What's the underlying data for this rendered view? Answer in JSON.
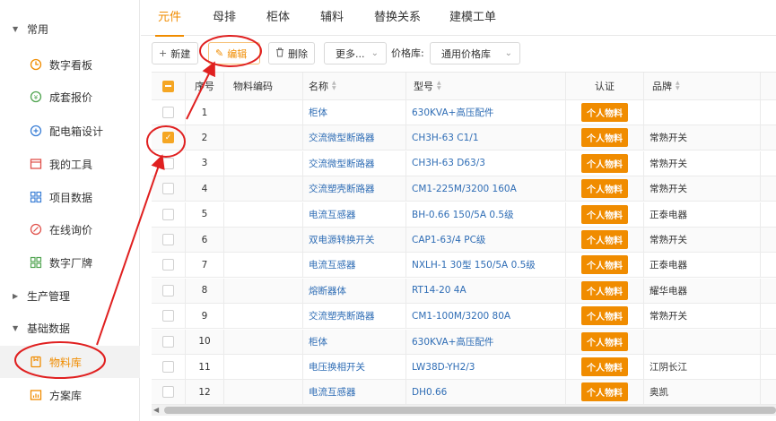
{
  "sidebar": {
    "groups": [
      {
        "label": "常用",
        "caret": "▼"
      },
      {
        "label": "生产管理",
        "caret": "▶"
      },
      {
        "label": "基础数据",
        "caret": "▼"
      }
    ],
    "items": [
      {
        "label": "数字看板",
        "icon": "dashboard-icon"
      },
      {
        "label": "成套报价",
        "icon": "quote-icon"
      },
      {
        "label": "配电箱设计",
        "icon": "design-icon"
      },
      {
        "label": "我的工具",
        "icon": "tools-icon"
      },
      {
        "label": "项目数据",
        "icon": "project-data-icon"
      },
      {
        "label": "在线询价",
        "icon": "inquiry-icon"
      },
      {
        "label": "数字厂牌",
        "icon": "brand-icon"
      },
      {
        "label": "物料库",
        "icon": "material-library-icon",
        "active": true
      },
      {
        "label": "方案库",
        "icon": "scheme-library-icon"
      }
    ]
  },
  "tabs": [
    "元件",
    "母排",
    "柜体",
    "辅料",
    "替换关系",
    "建模工单"
  ],
  "toolbar": {
    "new_label": "新建",
    "edit_label": "编辑",
    "delete_label": "删除",
    "more_label": "更多...",
    "price_lib_label": "价格库:",
    "price_lib_value": "通用价格库"
  },
  "table": {
    "headers": [
      "序号",
      "物料编码",
      "名称",
      "型号",
      "认证",
      "品牌"
    ],
    "rows": [
      {
        "no": "1",
        "code": "",
        "name": "柜体",
        "model": "630KVA+高压配件",
        "cert": "个人物料",
        "brand": "",
        "checked": false
      },
      {
        "no": "2",
        "code": "",
        "name": "交流微型断路器",
        "model": "CH3H-63 C1/1",
        "cert": "个人物料",
        "brand": "常熟开关",
        "checked": true
      },
      {
        "no": "3",
        "code": "",
        "name": "交流微型断路器",
        "model": "CH3H-63 D63/3",
        "cert": "个人物料",
        "brand": "常熟开关",
        "checked": false
      },
      {
        "no": "4",
        "code": "",
        "name": "交流塑壳断路器",
        "model": "CM1-225M/3200 160A",
        "cert": "个人物料",
        "brand": "常熟开关",
        "checked": false
      },
      {
        "no": "5",
        "code": "",
        "name": "电流互感器",
        "model": "BH-0.66 150/5A 0.5级",
        "cert": "个人物料",
        "brand": "正泰电器",
        "checked": false
      },
      {
        "no": "6",
        "code": "",
        "name": "双电源转换开关",
        "model": "CAP1-63/4 PC级",
        "cert": "个人物料",
        "brand": "常熟开关",
        "checked": false
      },
      {
        "no": "7",
        "code": "",
        "name": "电流互感器",
        "model": "NXLH-1 30型 150/5A 0.5级",
        "cert": "个人物料",
        "brand": "正泰电器",
        "checked": false
      },
      {
        "no": "8",
        "code": "",
        "name": "熔断器体",
        "model": "RT14-20 4A",
        "cert": "个人物料",
        "brand": "耀华电器",
        "checked": false
      },
      {
        "no": "9",
        "code": "",
        "name": "交流塑壳断路器",
        "model": "CM1-100M/3200 80A",
        "cert": "个人物料",
        "brand": "常熟开关",
        "checked": false
      },
      {
        "no": "10",
        "code": "",
        "name": "柜体",
        "model": "630KVA+高压配件",
        "cert": "个人物料",
        "brand": "",
        "checked": false
      },
      {
        "no": "11",
        "code": "",
        "name": "电压换相开关",
        "model": "LW38D-YH2/3",
        "cert": "个人物料",
        "brand": "江阴长江",
        "checked": false
      },
      {
        "no": "12",
        "code": "",
        "name": "电流互感器",
        "model": "DH0.66",
        "cert": "个人物料",
        "brand": "奥凯",
        "checked": false
      }
    ]
  },
  "colors": {
    "accent": "#f08c00",
    "link": "#2f6db5",
    "annotation": "#e02020"
  }
}
